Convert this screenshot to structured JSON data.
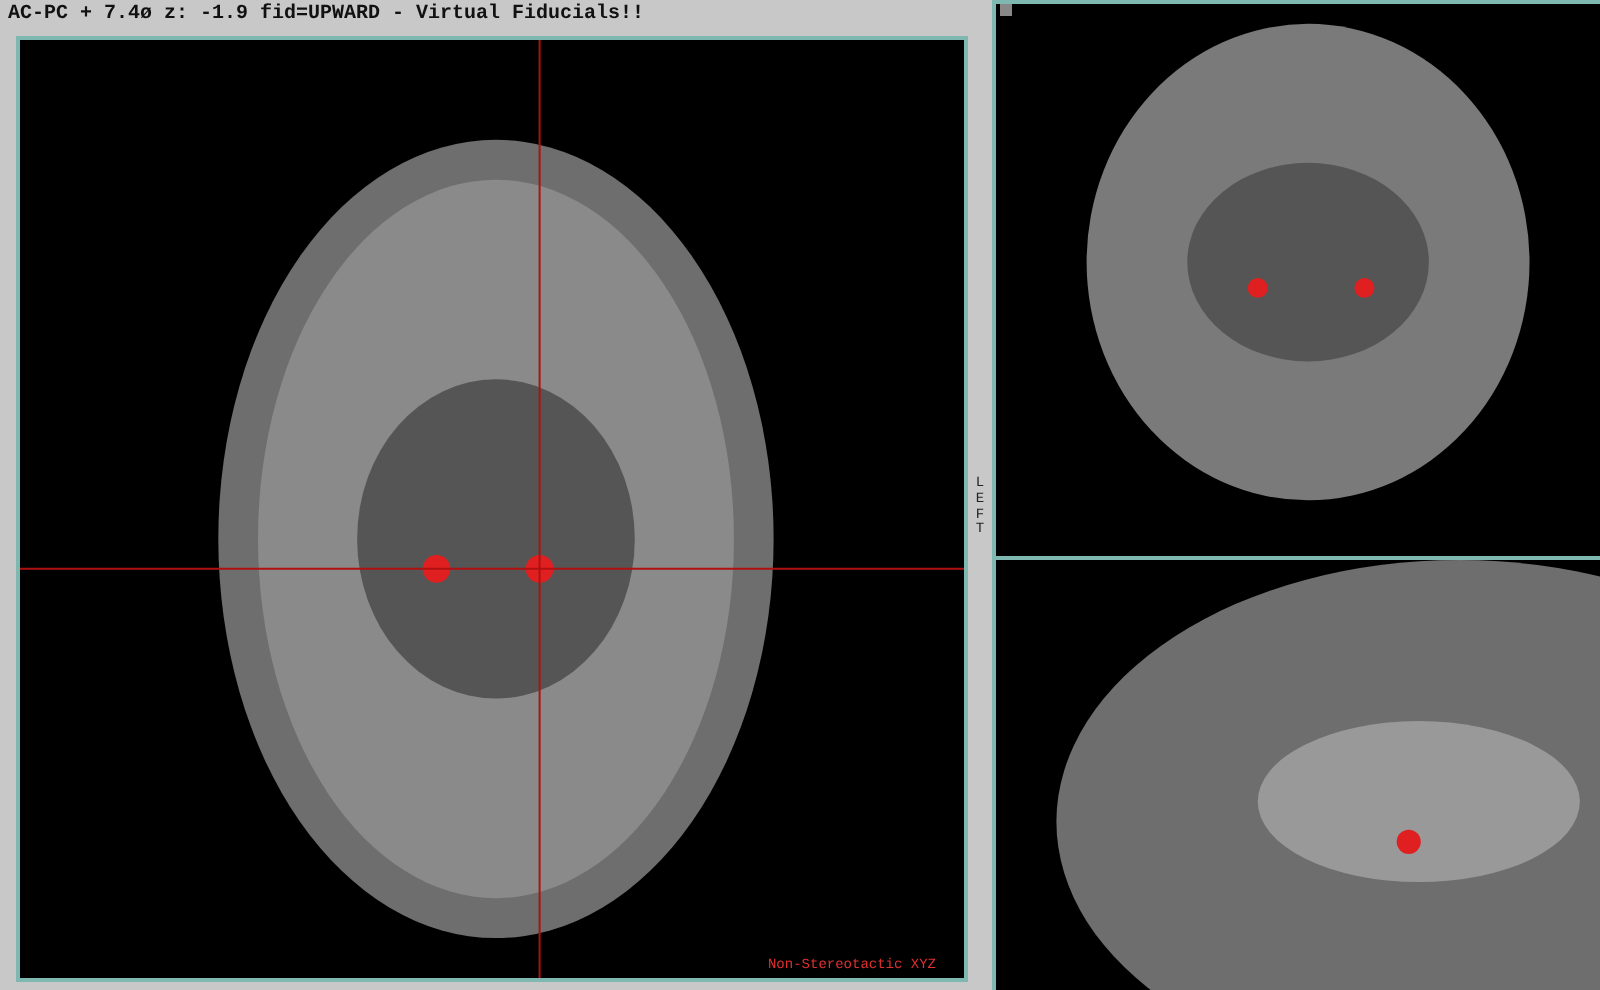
{
  "axial_view": {
    "title": "AC-PC + 7.4ø z: -1.9  fid=UPWARD - Virtual Fiducials!!",
    "side_label": "LEFT",
    "footer_label": "Non-Stereotactic XYZ"
  }
}
